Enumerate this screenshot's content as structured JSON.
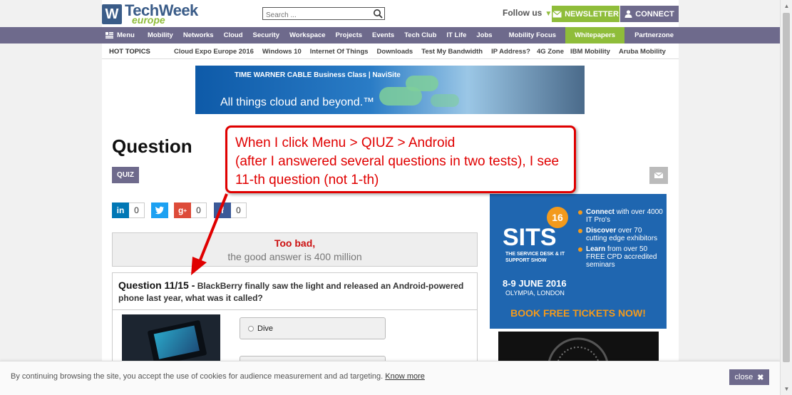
{
  "header": {
    "logo_main": "TechWeek",
    "logo_sub": "europe",
    "search_placeholder": "Search ...",
    "follow_label": "Follow us",
    "newsletter_label": "NEWSLETTER",
    "connect_label": "CONNECT"
  },
  "nav": {
    "menu_label": "Menu",
    "items": [
      "Mobility",
      "Networks",
      "Cloud",
      "Security",
      "Workspace",
      "Projects",
      "Events",
      "Tech Club",
      "IT Life",
      "Jobs",
      "Mobility Focus",
      "Whitepapers",
      "Partnerzone"
    ]
  },
  "hot_topics": {
    "title": "HOT TOPICS",
    "items": [
      "Cloud Expo Europe 2016",
      "Windows 10",
      "Internet Of Things",
      "Downloads",
      "Test My Bandwidth",
      "IP Address?",
      "4G Zone",
      "IBM Mobility",
      "Aruba Mobility"
    ]
  },
  "banner": {
    "brand": "TIME WARNER CABLE Business Class | NaviSite",
    "tagline": "All things cloud and beyond.™"
  },
  "page": {
    "title": "Question",
    "category_tag": "QUIZ"
  },
  "share": {
    "linkedin_count": "0",
    "googleplus_count": "0",
    "facebook_count": "0"
  },
  "result": {
    "headline": "Too bad,",
    "answer_text": "the good answer is 400 million"
  },
  "question": {
    "number": "Question 11/15 -",
    "text": "BlackBerry finally saw the light and released an Android-powered phone last year, what was it called?",
    "options": [
      "Dive",
      ""
    ]
  },
  "ad": {
    "number": "16",
    "name": "SITS",
    "subtitle": "THE SERVICE DESK & IT SUPPORT SHOW",
    "dates": "8-9 JUNE 2016",
    "location": "OLYMPIA, LONDON",
    "bullet1_bold": "Connect",
    "bullet1_rest": "with over 4000 IT Pro's",
    "bullet2_bold": "Discover",
    "bullet2_rest": "over 70 cutting edge exhibitors",
    "bullet3_bold": "Learn",
    "bullet3_rest": "from over 50 FREE CPD accredited seminars",
    "cta": "BOOK FREE TICKETS NOW!"
  },
  "annotation": {
    "line1": "When I click Menu > QIUZ > Android",
    "line2": "(after I answered several questions in two tests), I see",
    "line3": "11-th question (not 1-th)"
  },
  "cookie": {
    "text": "By continuing browsing the site, you accept the use of cookies for audience measurement and ad targeting.",
    "link": "Know more",
    "close_label": "close"
  },
  "colors": {
    "nav_purple": "#6e6a8c",
    "accent_green": "#8fbd3a",
    "annotation_red": "#e00000",
    "error_red": "#cc1111"
  }
}
